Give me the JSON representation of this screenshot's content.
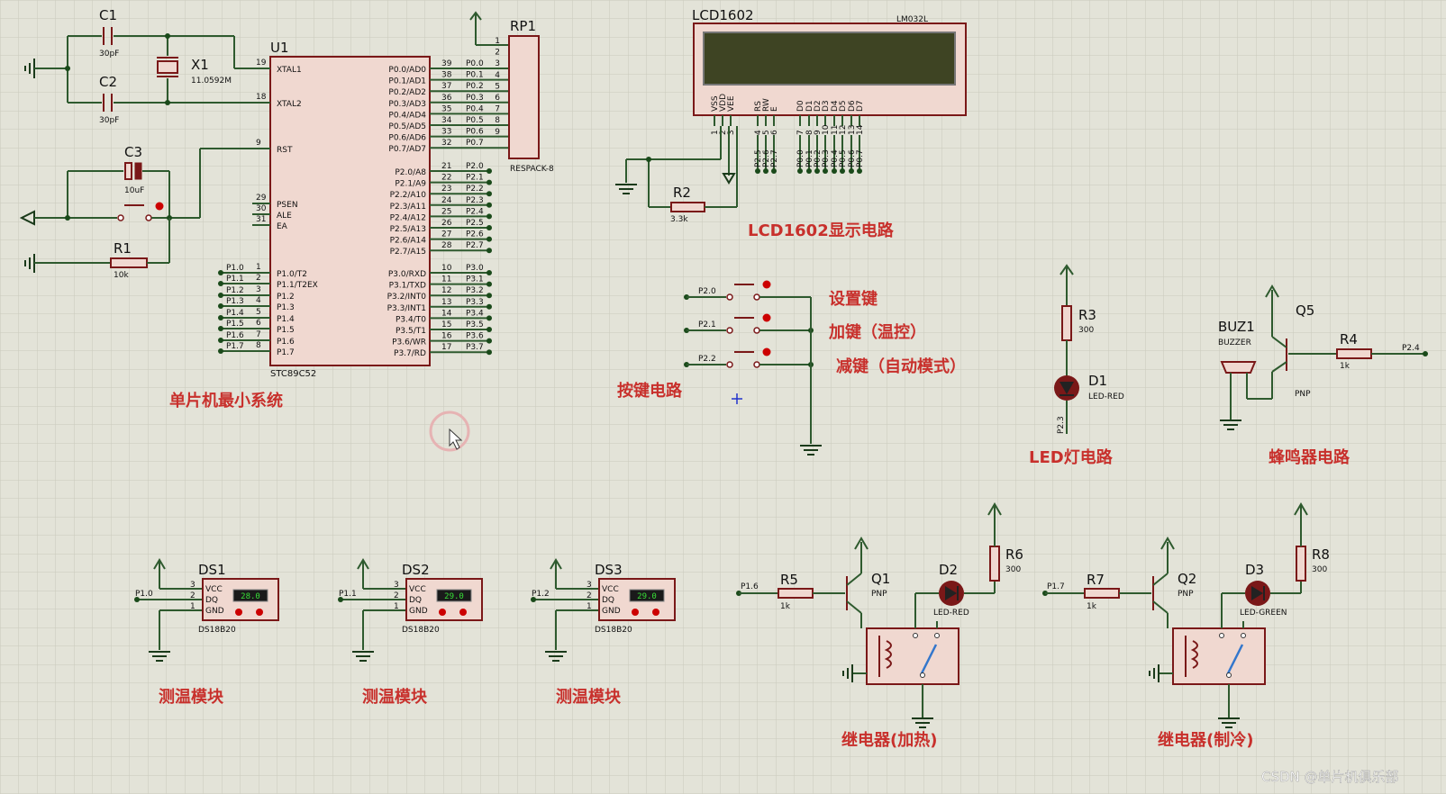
{
  "components": {
    "c1": {
      "ref": "C1",
      "value": "30pF"
    },
    "c2": {
      "ref": "C2",
      "value": "30pF"
    },
    "c3": {
      "ref": "C3",
      "value": "10uF"
    },
    "x1": {
      "ref": "X1",
      "value": "11.0592M"
    },
    "r1": {
      "ref": "R1",
      "value": "10k"
    },
    "u1": {
      "ref": "U1",
      "part": "STC89C52",
      "left_pins": [
        {
          "num": "19",
          "name": "XTAL1"
        },
        {
          "num": "18",
          "name": "XTAL2"
        },
        {
          "num": "9",
          "name": "RST"
        },
        {
          "num": "29",
          "name": "PSEN"
        },
        {
          "num": "30",
          "name": "ALE"
        },
        {
          "num": "31",
          "name": "EA"
        },
        {
          "num": "1",
          "name": "P1.0/T2"
        },
        {
          "num": "2",
          "name": "P1.1/T2EX"
        },
        {
          "num": "3",
          "name": "P1.2"
        },
        {
          "num": "4",
          "name": "P1.3"
        },
        {
          "num": "5",
          "name": "P1.4"
        },
        {
          "num": "6",
          "name": "P1.5"
        },
        {
          "num": "7",
          "name": "P1.6"
        },
        {
          "num": "8",
          "name": "P1.7"
        }
      ],
      "right_p0": [
        {
          "num": "39",
          "name": "P0.0/AD0"
        },
        {
          "num": "38",
          "name": "P0.1/AD1"
        },
        {
          "num": "37",
          "name": "P0.2/AD2"
        },
        {
          "num": "36",
          "name": "P0.3/AD3"
        },
        {
          "num": "35",
          "name": "P0.4/AD4"
        },
        {
          "num": "34",
          "name": "P0.5/AD5"
        },
        {
          "num": "33",
          "name": "P0.6/AD6"
        },
        {
          "num": "32",
          "name": "P0.7/AD7"
        }
      ],
      "right_p2": [
        {
          "num": "21",
          "name": "P2.0/A8"
        },
        {
          "num": "22",
          "name": "P2.1/A9"
        },
        {
          "num": "23",
          "name": "P2.2/A10"
        },
        {
          "num": "24",
          "name": "P2.3/A11"
        },
        {
          "num": "25",
          "name": "P2.4/A12"
        },
        {
          "num": "26",
          "name": "P2.5/A13"
        },
        {
          "num": "27",
          "name": "P2.6/A14"
        },
        {
          "num": "28",
          "name": "P2.7/A15"
        }
      ],
      "right_p3": [
        {
          "num": "10",
          "name": "P3.0/RXD"
        },
        {
          "num": "11",
          "name": "P3.1/TXD"
        },
        {
          "num": "12",
          "name": "P3.2/INT0"
        },
        {
          "num": "13",
          "name": "P3.3/INT1"
        },
        {
          "num": "14",
          "name": "P3.4/T0"
        },
        {
          "num": "15",
          "name": "P3.5/T1"
        },
        {
          "num": "16",
          "name": "P3.6/WR"
        },
        {
          "num": "17",
          "name": "P3.7/RD"
        }
      ]
    },
    "rp1": {
      "ref": "RP1",
      "part": "RESPACK-8",
      "pins": [
        "1",
        "2",
        "3",
        "4",
        "5",
        "6",
        "7",
        "8",
        "9"
      ]
    },
    "lcd": {
      "ref": "LCD1602",
      "model": "LM032L",
      "pins": [
        "VSS",
        "VDD",
        "VEE",
        "RS",
        "RW",
        "E",
        "D0",
        "D1",
        "D2",
        "D3",
        "D4",
        "D5",
        "D6",
        "D7"
      ],
      "pin_nums": [
        "1",
        "2",
        "3",
        "4",
        "5",
        "6",
        "7",
        "8",
        "9",
        "10",
        "11",
        "12",
        "13",
        "14"
      ],
      "nets": [
        "P2.5",
        "P2.6",
        "P2.7",
        "P0.0",
        "P0.1",
        "P0.2",
        "P0.3",
        "P0.4",
        "P0.5",
        "P0.6",
        "P0.7"
      ]
    },
    "r2": {
      "ref": "R2",
      "value": "3.3k"
    },
    "r3": {
      "ref": "R3",
      "value": "300"
    },
    "d1": {
      "ref": "D1",
      "part": "LED-RED"
    },
    "buz1": {
      "ref": "BUZ1",
      "part": "BUZZER"
    },
    "q5": {
      "ref": "Q5",
      "part": "PNP"
    },
    "r4": {
      "ref": "R4",
      "value": "1k"
    },
    "ds1": {
      "ref": "DS1",
      "part": "DS18B20",
      "reading": "28.0"
    },
    "ds2": {
      "ref": "DS2",
      "part": "DS18B20",
      "reading": "29.0"
    },
    "ds3": {
      "ref": "DS3",
      "part": "DS18B20",
      "reading": "29.0"
    },
    "ds_pins": [
      "VCC",
      "DQ",
      "GND"
    ],
    "ds_pin_nums": [
      "3",
      "2",
      "1"
    ],
    "r5": {
      "ref": "R5",
      "value": "1k"
    },
    "q1": {
      "ref": "Q1",
      "part": "PNP"
    },
    "d2": {
      "ref": "D2",
      "part": "LED-RED"
    },
    "r6": {
      "ref": "R6",
      "value": "300"
    },
    "r7": {
      "ref": "R7",
      "value": "1k"
    },
    "q2": {
      "ref": "Q2",
      "part": "PNP"
    },
    "d3": {
      "ref": "D3",
      "part": "LED-GREEN"
    },
    "r8": {
      "ref": "R8",
      "value": "300"
    }
  },
  "nets": {
    "p0": [
      "P0.0",
      "P0.1",
      "P0.2",
      "P0.3",
      "P0.4",
      "P0.5",
      "P0.6",
      "P0.7"
    ],
    "p1": [
      "P1.0",
      "P1.1",
      "P1.2",
      "P1.3",
      "P1.4",
      "P1.5",
      "P1.6",
      "P1.7"
    ],
    "p2": [
      "P2.0",
      "P2.1",
      "P2.2",
      "P2.3",
      "P2.4",
      "P2.5",
      "P2.6",
      "P2.7"
    ],
    "p3": [
      "P3.0",
      "P3.1",
      "P3.2",
      "P3.3",
      "P3.4",
      "P3.5",
      "P3.6",
      "P3.7"
    ],
    "key_nets": [
      "P2.0",
      "P2.1",
      "P2.2"
    ],
    "d1_net": "P2.3",
    "buz_net": "P2.4",
    "ds_nets": [
      "P1.0",
      "P1.1",
      "P1.2"
    ],
    "relay1_net": "P1.6",
    "relay2_net": "P1.7"
  },
  "section_labels": {
    "mcu": "单片机最小系统",
    "lcd": "LCD1602显示电路",
    "keys": "按键电路",
    "led": "LED灯电路",
    "buzzer": "蜂鸣器电路",
    "temp1": "测温模块",
    "temp2": "测温模块",
    "temp3": "测温模块",
    "relay_heat": "继电器(加热)",
    "relay_cool": "继电器(制冷)"
  },
  "key_labels": [
    "设置键",
    "加键（温控）",
    "减键（自动模式）"
  ],
  "watermark": "CSDN @单片机俱乐部"
}
